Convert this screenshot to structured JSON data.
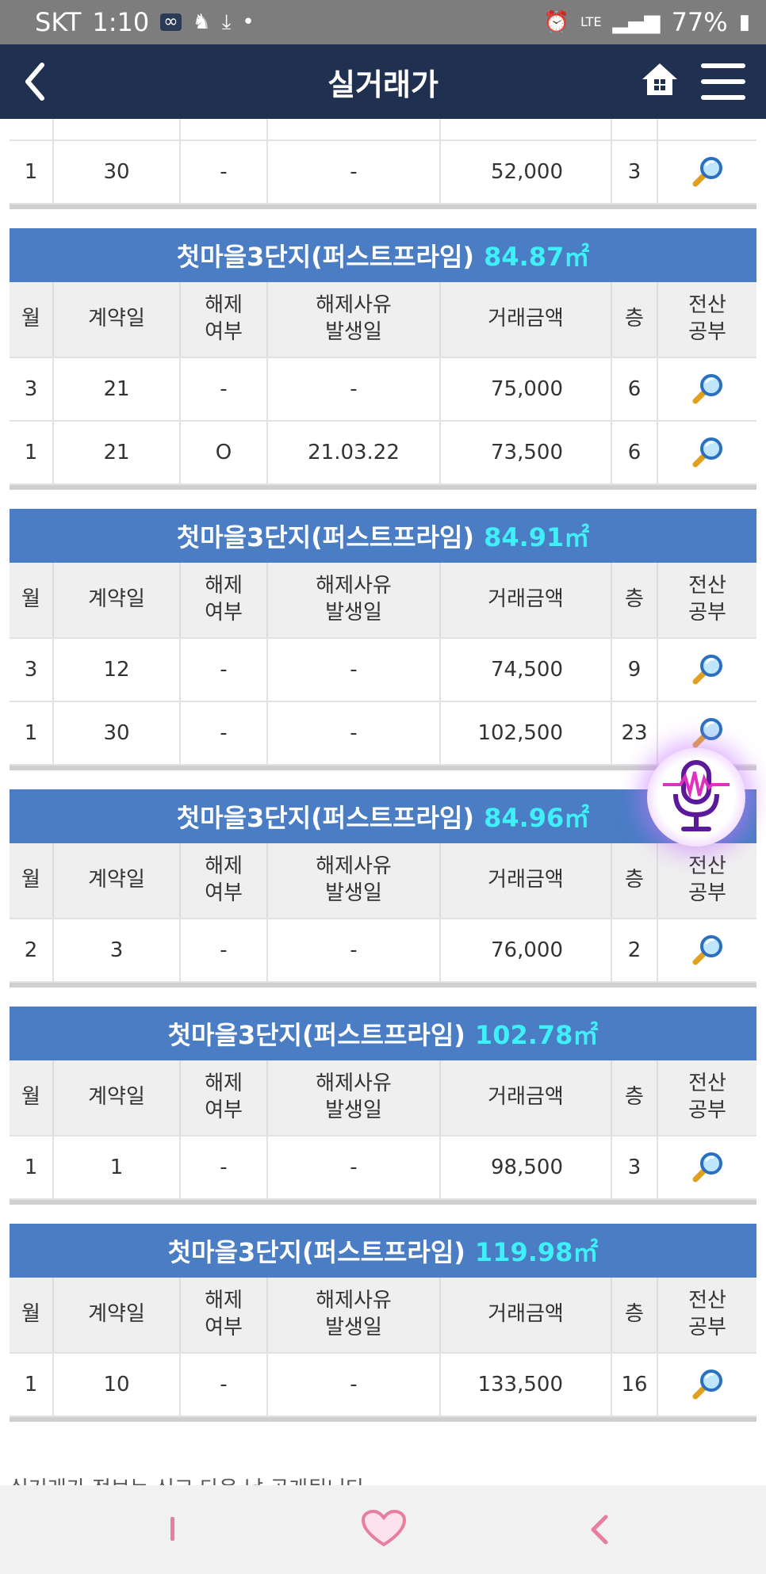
{
  "status_bar": {
    "carrier": "SKT",
    "time": "1:10",
    "network": "LTE",
    "battery": "77%"
  },
  "header": {
    "title": "실거래가"
  },
  "columns": {
    "month": "월",
    "contract_day": "계약일",
    "cancel": "해제\n여부",
    "cancel_date": "해제사유\n발생일",
    "price": "거래금액",
    "floor": "층",
    "registry": "전산\n공부"
  },
  "partial_section": {
    "rows": [
      {
        "month": "1",
        "day": "30",
        "cancel": "-",
        "cancel_date": "-",
        "price": "52,000",
        "floor": "3"
      }
    ]
  },
  "sections": [
    {
      "complex": "첫마을3단지(퍼스트프라임)",
      "size": "84.87㎡",
      "rows": [
        {
          "month": "3",
          "day": "21",
          "cancel": "-",
          "cancel_date": "-",
          "price": "75,000",
          "floor": "6"
        },
        {
          "month": "1",
          "day": "21",
          "cancel": "O",
          "cancel_date": "21.03.22",
          "price": "73,500",
          "floor": "6"
        }
      ]
    },
    {
      "complex": "첫마을3단지(퍼스트프라임)",
      "size": "84.91㎡",
      "rows": [
        {
          "month": "3",
          "day": "12",
          "cancel": "-",
          "cancel_date": "-",
          "price": "74,500",
          "floor": "9"
        },
        {
          "month": "1",
          "day": "30",
          "cancel": "-",
          "cancel_date": "-",
          "price": "102,500",
          "floor": "23"
        }
      ]
    },
    {
      "complex": "첫마을3단지(퍼스트프라임)",
      "size": "84.96㎡",
      "rows": [
        {
          "month": "2",
          "day": "3",
          "cancel": "-",
          "cancel_date": "-",
          "price": "76,000",
          "floor": "2"
        }
      ]
    },
    {
      "complex": "첫마을3단지(퍼스트프라임)",
      "size": "102.78㎡",
      "rows": [
        {
          "month": "1",
          "day": "1",
          "cancel": "-",
          "cancel_date": "-",
          "price": "98,500",
          "floor": "3"
        }
      ]
    },
    {
      "complex": "첫마을3단지(퍼스트프라임)",
      "size": "119.98㎡",
      "rows": [
        {
          "month": "1",
          "day": "10",
          "cancel": "-",
          "cancel_date": "-",
          "price": "133,500",
          "floor": "16"
        }
      ]
    }
  ],
  "footer_note": "실거래가 정보는 신고 다음 날 공개됩니다.",
  "icons": {
    "registry": "magnifier-icon",
    "fab": "voice-mic-icon"
  },
  "colors": {
    "header_bg": "#203050",
    "section_title_bg": "#4a7dc4",
    "size_accent": "#3ff0f8"
  }
}
